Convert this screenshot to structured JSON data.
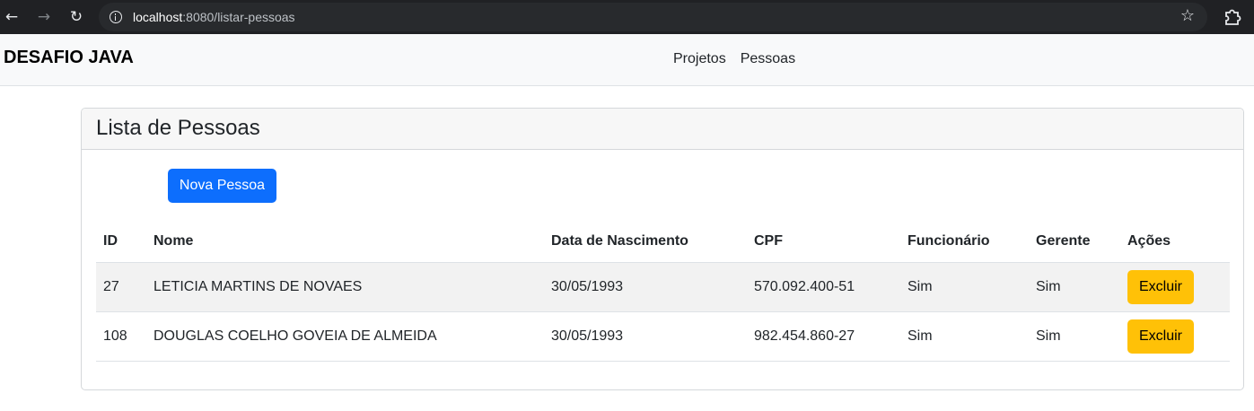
{
  "browser": {
    "url_host": "localhost",
    "url_path": ":8080/listar-pessoas",
    "back_icon": "arrow-left-icon",
    "forward_icon": "arrow-right-icon",
    "reload_icon": "reload-icon",
    "back_glyph": "←",
    "forward_glyph": "→",
    "reload_glyph": "↻",
    "star_glyph": "☆"
  },
  "navbar": {
    "brand": "DESAFIO JAVA",
    "links": [
      "Projetos",
      "Pessoas"
    ]
  },
  "card": {
    "title": "Lista de Pessoas",
    "new_button": "Nova Pessoa"
  },
  "table": {
    "headers": [
      "ID",
      "Nome",
      "Data de Nascimento",
      "CPF",
      "Funcionário",
      "Gerente",
      "Ações"
    ],
    "rows": [
      {
        "id": "27",
        "nome": "LETICIA MARTINS DE NOVAES",
        "data": "30/05/1993",
        "cpf": "570.092.400-51",
        "funcionario": "Sim",
        "gerente": "Sim",
        "acao": "Excluir"
      },
      {
        "id": "108",
        "nome": "DOUGLAS COELHO GOVEIA DE ALMEIDA",
        "data": "30/05/1993",
        "cpf": "982.454.860-27",
        "funcionario": "Sim",
        "gerente": "Sim",
        "acao": "Excluir"
      }
    ]
  },
  "colors": {
    "primary": "#0d6efd",
    "warning": "#ffc107",
    "navbar_bg": "#f8f9fa"
  }
}
